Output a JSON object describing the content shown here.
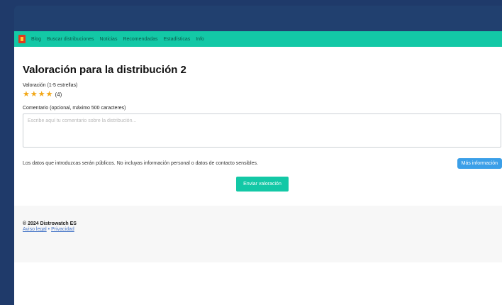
{
  "nav": {
    "links": [
      "Blog",
      "Buscar distribuciones",
      "Noticias",
      "Recomendadas",
      "Estadísticas",
      "Info"
    ]
  },
  "page": {
    "title": "Valoración para la distribución 2",
    "rating_label": "Valoración (1-5 estrellas)",
    "stars_filled": 4,
    "stars_total": 5,
    "star_count_text": "(4)",
    "comment_label": "Comentario (opcional, máximo 500 caracteres)",
    "comment_placeholder": "Escribe aquí tu comentario sobre la distribución...",
    "info_text": "Los datos que introduzcas serán públicos. No incluyas información personal o datos de contacto sensibles.",
    "help_button": "Más información",
    "submit_button": "Enviar valoración"
  },
  "footer": {
    "title": "© 2024 Distrowatch ES",
    "link1": "Aviso legal",
    "separator": " • ",
    "link2": "Privacidad"
  },
  "colors": {
    "navbar": "#13c8a6",
    "accent_blue": "#3b9fe8",
    "star": "#f2a716",
    "desktop": "#1f3a6a"
  }
}
